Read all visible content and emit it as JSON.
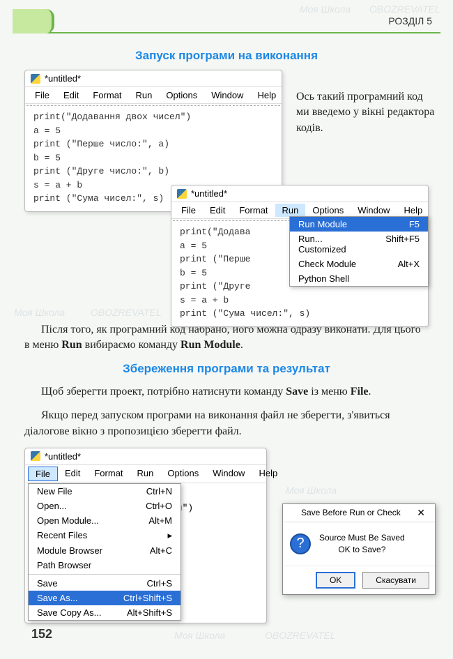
{
  "header": {
    "section": "РОЗДІЛ 5"
  },
  "heading1": "Запуск програми на виконання",
  "heading2": "Збереження програми та результат",
  "sidenote": "Ось такий програмний код ми введемо у вікні редактора кодів.",
  "para1": "Після того, як програмний код набрано, його можна одразу виконати. Для цього в меню ",
  "para1_b1": "Run",
  "para1_mid": " вибираємо команду ",
  "para1_b2": "Run Module",
  "para1_end": ".",
  "para2": "Щоб зберегти проект, потрібно натиснути команду ",
  "para2_b1": "Save",
  "para2_mid": " із меню ",
  "para2_b2": "File",
  "para2_end": ".",
  "para3": "Якщо перед запуском програми на виконання файл не зберегти, з'явиться діалогове вікно з пропозицією зберегти файл.",
  "win1": {
    "title": "*untitled*",
    "menu": [
      "File",
      "Edit",
      "Format",
      "Run",
      "Options",
      "Window",
      "Help"
    ],
    "code": "print(\"Додавання двох чисел\")\na = 5\nprint (\"Перше число:\", a)\nb = 5\nprint (\"Друге число:\", b)\ns = a + b\nprint (\"Сума чисел:\", s)"
  },
  "win2": {
    "title": "*untitled*",
    "menu": [
      "File",
      "Edit",
      "Format",
      "Run",
      "Options",
      "Window",
      "Help"
    ],
    "code": "print(\"Додава\na = 5\nprint (\"Перше\nb = 5\nprint (\"Друге\ns = a + b\nprint (\"Сума чисел:\", s)",
    "menu_run": [
      {
        "label": "Run Module",
        "sc": "F5",
        "sel": true
      },
      {
        "label": "Run... Customized",
        "sc": "Shift+F5"
      },
      {
        "label": "Check Module",
        "sc": "Alt+X"
      },
      {
        "label": "Python Shell",
        "sc": ""
      }
    ]
  },
  "win3": {
    "title": "*untitled*",
    "menu": [
      "File",
      "Edit",
      "Format",
      "Run",
      "Options",
      "Window",
      "Help"
    ],
    "code_frag": "ел\")",
    "menu_file": [
      {
        "label": "New File",
        "sc": "Ctrl+N"
      },
      {
        "label": "Open...",
        "sc": "Ctrl+O"
      },
      {
        "label": "Open Module...",
        "sc": "Alt+M"
      },
      {
        "label": "Recent Files",
        "sc": "▸"
      },
      {
        "label": "Module Browser",
        "sc": "Alt+C"
      },
      {
        "label": "Path Browser",
        "sc": ""
      },
      {
        "sep": true
      },
      {
        "label": "Save",
        "sc": "Ctrl+S"
      },
      {
        "label": "Save As...",
        "sc": "Ctrl+Shift+S",
        "sel": true
      },
      {
        "label": "Save Copy As...",
        "sc": "Alt+Shift+S"
      }
    ]
  },
  "dialog": {
    "title": "Save Before Run or Check",
    "body1": "Source Must Be Saved",
    "body2": "OK to Save?",
    "ok": "OK",
    "cancel": "Скасувати"
  },
  "page_number": "152",
  "watermarks": [
    "Моя Школа",
    "OBOZREVATEL"
  ]
}
